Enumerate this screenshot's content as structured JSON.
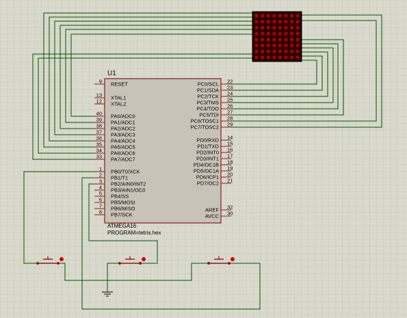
{
  "colors": {
    "background": "#d9d9cd",
    "grid": "#c3c3b4",
    "wire": "#005800",
    "chip_body": "#c8c3b8",
    "chip_border": "#8b1a1a",
    "pin_line": "#8b1a1a",
    "led_off": "#2a0000",
    "led_on": "#c80000",
    "button": "#8b1a1a"
  },
  "chip": {
    "reference": "U1",
    "part": "ATMEGA16",
    "program": "PROGRAM=tetris.hex",
    "left_pins": [
      {
        "num": "9",
        "name": "RESET"
      },
      {
        "num": "13",
        "name": "XTAL1"
      },
      {
        "num": "12",
        "name": "XTAL2"
      },
      {
        "num": "40",
        "name": "PA0/ADC0"
      },
      {
        "num": "39",
        "name": "PA1/ADC1"
      },
      {
        "num": "38",
        "name": "PA2/ADC2"
      },
      {
        "num": "37",
        "name": "PA3/ADC3"
      },
      {
        "num": "36",
        "name": "PA4/ADC4"
      },
      {
        "num": "35",
        "name": "PA5/ADC5"
      },
      {
        "num": "34",
        "name": "PA6/ADC6"
      },
      {
        "num": "33",
        "name": "PA7/ADC7"
      },
      {
        "num": "1",
        "name": "PB0/T0/XCK"
      },
      {
        "num": "2",
        "name": "PB1/T1"
      },
      {
        "num": "3",
        "name": "PB2/AIN0/INT2"
      },
      {
        "num": "4",
        "name": "PB3/AIN1/OC0"
      },
      {
        "num": "5",
        "name": "PB4/SS"
      },
      {
        "num": "6",
        "name": "PB5/MOSI"
      },
      {
        "num": "7",
        "name": "PB6/MISO"
      },
      {
        "num": "8",
        "name": "PB7/SCK"
      }
    ],
    "right_pins": [
      {
        "num": "22",
        "name": "PC0/SCL"
      },
      {
        "num": "23",
        "name": "PC1/SDA"
      },
      {
        "num": "24",
        "name": "PC2/TCK"
      },
      {
        "num": "25",
        "name": "PC3/TMS"
      },
      {
        "num": "26",
        "name": "PC4/TDO"
      },
      {
        "num": "27",
        "name": "PC5/TDI"
      },
      {
        "num": "28",
        "name": "PC6/TOSC1"
      },
      {
        "num": "29",
        "name": "PC7/TOSC2"
      },
      {
        "num": "14",
        "name": "PD0/RXD"
      },
      {
        "num": "15",
        "name": "PD1/TXD"
      },
      {
        "num": "16",
        "name": "PD2/INT0"
      },
      {
        "num": "17",
        "name": "PD3/INT1"
      },
      {
        "num": "18",
        "name": "PD4/OC1B"
      },
      {
        "num": "19",
        "name": "PD5/OC1A"
      },
      {
        "num": "20",
        "name": "PD6/ICP1"
      },
      {
        "num": "21",
        "name": "PD7/OC2"
      },
      {
        "num": "32",
        "name": "AREF"
      },
      {
        "num": "30",
        "name": "AVCC"
      }
    ]
  },
  "led_matrix": {
    "rows": 8,
    "cols": 8
  },
  "buttons_count": 3
}
